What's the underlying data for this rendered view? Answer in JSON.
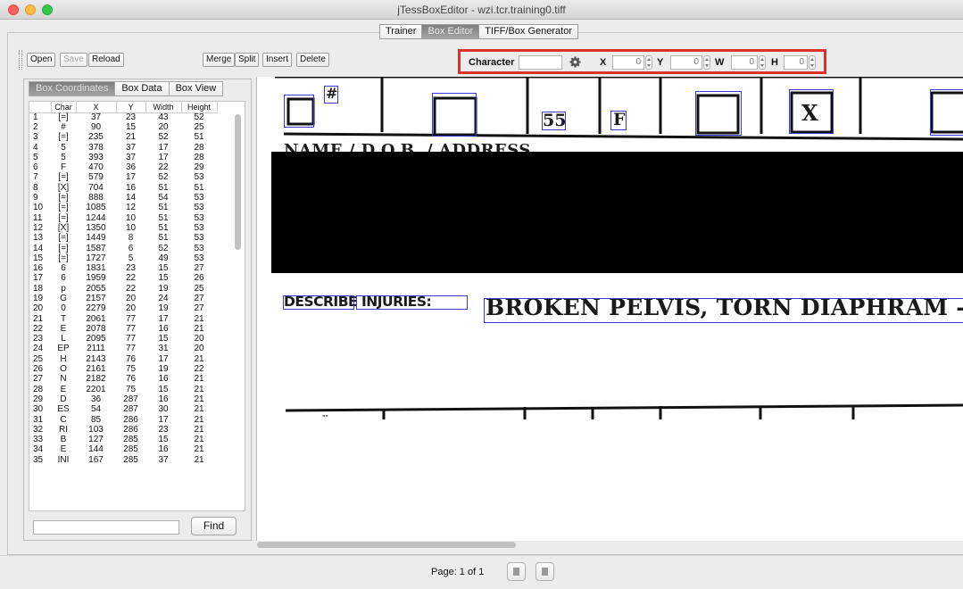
{
  "window": {
    "title": "jTessBoxEditor - wzi.tcr.training0.tiff"
  },
  "tabs": [
    "Trainer",
    "Box Editor",
    "TIFF/Box Generator"
  ],
  "toolbar": {
    "open": "Open",
    "save": "Save",
    "reload": "Reload",
    "merge": "Merge",
    "split": "Split",
    "insert": "Insert",
    "delete": "Delete"
  },
  "char_panel": {
    "character_label": "Character",
    "character_value": "",
    "x_label": "X",
    "x_value": "0",
    "y_label": "Y",
    "y_value": "0",
    "w_label": "W",
    "w_value": "0",
    "h_label": "H",
    "h_value": "0",
    "gear_icon": "gear-icon"
  },
  "panel_tabs": [
    "Box Coordinates",
    "Box Data",
    "Box View"
  ],
  "table": {
    "headers": [
      "",
      "Char",
      "X",
      "Y",
      "Width",
      "Height"
    ],
    "rows": [
      [
        "1",
        "[=]",
        "37",
        "23",
        "43",
        "52"
      ],
      [
        "2",
        "#",
        "90",
        "15",
        "20",
        "25"
      ],
      [
        "3",
        "[=]",
        "235",
        "21",
        "52",
        "51"
      ],
      [
        "4",
        "5",
        "378",
        "37",
        "17",
        "28"
      ],
      [
        "5",
        "5",
        "393",
        "37",
        "17",
        "28"
      ],
      [
        "6",
        "F",
        "470",
        "36",
        "22",
        "29"
      ],
      [
        "7",
        "[=]",
        "579",
        "17",
        "52",
        "53"
      ],
      [
        "8",
        "[X]",
        "704",
        "16",
        "51",
        "51"
      ],
      [
        "9",
        "[=]",
        "888",
        "14",
        "54",
        "53"
      ],
      [
        "10",
        "[=]",
        "1085",
        "12",
        "51",
        "53"
      ],
      [
        "11",
        "[=]",
        "1244",
        "10",
        "51",
        "53"
      ],
      [
        "12",
        "[X]",
        "1350",
        "10",
        "51",
        "53"
      ],
      [
        "13",
        "[=]",
        "1449",
        "8",
        "51",
        "53"
      ],
      [
        "14",
        "[=]",
        "1587",
        "6",
        "52",
        "53"
      ],
      [
        "15",
        "[=]",
        "1727",
        "5",
        "49",
        "53"
      ],
      [
        "16",
        "6",
        "1831",
        "23",
        "15",
        "27"
      ],
      [
        "17",
        "6",
        "1959",
        "22",
        "15",
        "26"
      ],
      [
        "18",
        "p",
        "2055",
        "22",
        "19",
        "25"
      ],
      [
        "19",
        "G",
        "2157",
        "20",
        "24",
        "27"
      ],
      [
        "20",
        "0",
        "2279",
        "20",
        "19",
        "27"
      ],
      [
        "21",
        "T",
        "2061",
        "77",
        "17",
        "21"
      ],
      [
        "22",
        "E",
        "2078",
        "77",
        "16",
        "21"
      ],
      [
        "23",
        "L",
        "2095",
        "77",
        "15",
        "20"
      ],
      [
        "24",
        "EP",
        "2111",
        "77",
        "31",
        "20"
      ],
      [
        "25",
        "H",
        "2143",
        "76",
        "17",
        "21"
      ],
      [
        "26",
        "O",
        "2161",
        "75",
        "19",
        "22"
      ],
      [
        "27",
        "N",
        "2182",
        "76",
        "16",
        "21"
      ],
      [
        "28",
        "E",
        "2201",
        "75",
        "15",
        "21"
      ],
      [
        "29",
        "D",
        "36",
        "287",
        "16",
        "21"
      ],
      [
        "30",
        "ES",
        "54",
        "287",
        "30",
        "21"
      ],
      [
        "31",
        "C",
        "85",
        "286",
        "17",
        "21"
      ],
      [
        "32",
        "RI",
        "103",
        "286",
        "23",
        "21"
      ],
      [
        "33",
        "B",
        "127",
        "285",
        "15",
        "21"
      ],
      [
        "34",
        "E",
        "144",
        "285",
        "16",
        "21"
      ],
      [
        "35",
        "INI",
        "167",
        "285",
        "37",
        "21"
      ]
    ]
  },
  "find": {
    "button": "Find",
    "value": ""
  },
  "document": {
    "hash": "#",
    "num55": "55",
    "letterF": "F",
    "letterX": "X",
    "partial_heading": "NAME / D.O.B. / ADDRESS",
    "describe": "DESCRIBE INJURIES:",
    "injury_text": "BROKEN PELVIS, TORN DIAPHRAM - F",
    "small_mark": "--"
  },
  "status": {
    "page": "Page: 1 of 1"
  }
}
